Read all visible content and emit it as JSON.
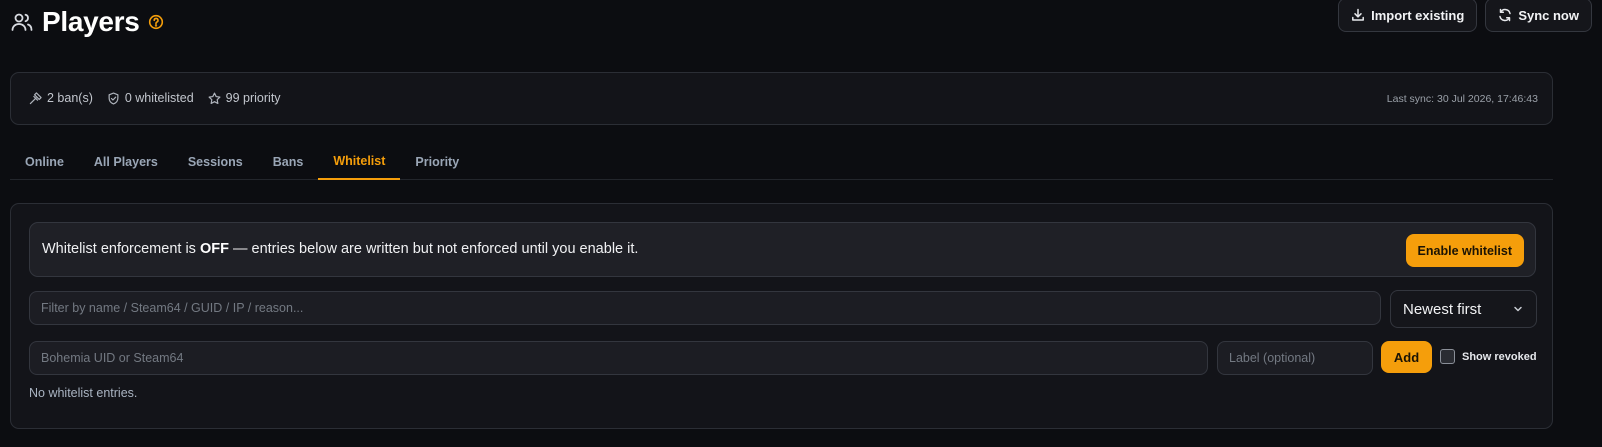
{
  "header": {
    "title": "Players",
    "title_icon": "users-icon",
    "help_icon": "help-circle-icon",
    "actions": [
      {
        "label": "Import existing",
        "icon": "download-icon"
      },
      {
        "label": "Sync now",
        "icon": "refresh-icon"
      }
    ]
  },
  "stats": {
    "bans": {
      "label": "2 ban(s)",
      "icon": "hammer-icon"
    },
    "whitelisted": {
      "label": "0 whitelisted",
      "icon": "shield-check-icon"
    },
    "priority": {
      "label": "99 priority",
      "icon": "star-icon"
    },
    "last_sync": "Last sync: 30 Jul 2026, 17:46:43"
  },
  "tabs": [
    {
      "label": "Online",
      "active": false
    },
    {
      "label": "All Players",
      "active": false
    },
    {
      "label": "Sessions",
      "active": false
    },
    {
      "label": "Bans",
      "active": false
    },
    {
      "label": "Whitelist",
      "active": true
    },
    {
      "label": "Priority",
      "active": false
    }
  ],
  "notice": {
    "prefix": "Whitelist enforcement is ",
    "state": "OFF",
    "suffix": " — entries below are written but not enforced until you enable it.",
    "button": "Enable whitelist"
  },
  "filter": {
    "placeholder": "Filter by name / Steam64 / GUID / IP / reason...",
    "value": ""
  },
  "sort": {
    "selected": "Newest first",
    "icon": "chevron-down-icon"
  },
  "add_form": {
    "uid_placeholder": "Bohemia UID or Steam64",
    "label_placeholder": "Label (optional)",
    "add_button": "Add",
    "show_revoked_label": "Show revoked",
    "show_revoked_checked": false
  },
  "empty_message": "No whitelist entries.",
  "colors": {
    "accent": "#f59e0b",
    "background": "#0c0d11",
    "card": "#131419"
  }
}
